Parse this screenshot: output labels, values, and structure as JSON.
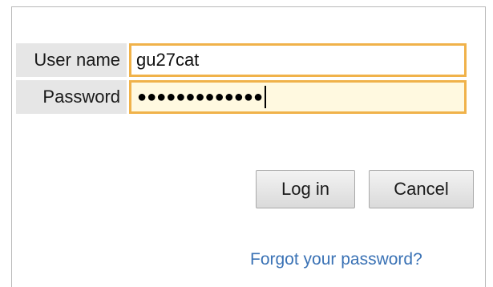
{
  "form": {
    "username_label": "User name",
    "username_value": "gu27cat",
    "password_label": "Password",
    "password_mask": "●●●●●●●●●●●●●",
    "accent_border_color": "#f0b24a",
    "password_field_background": "#fff9e0"
  },
  "buttons": {
    "login_label": "Log in",
    "cancel_label": "Cancel"
  },
  "links": {
    "forgot_password": "Forgot your password?",
    "link_color": "#3a72b5"
  }
}
